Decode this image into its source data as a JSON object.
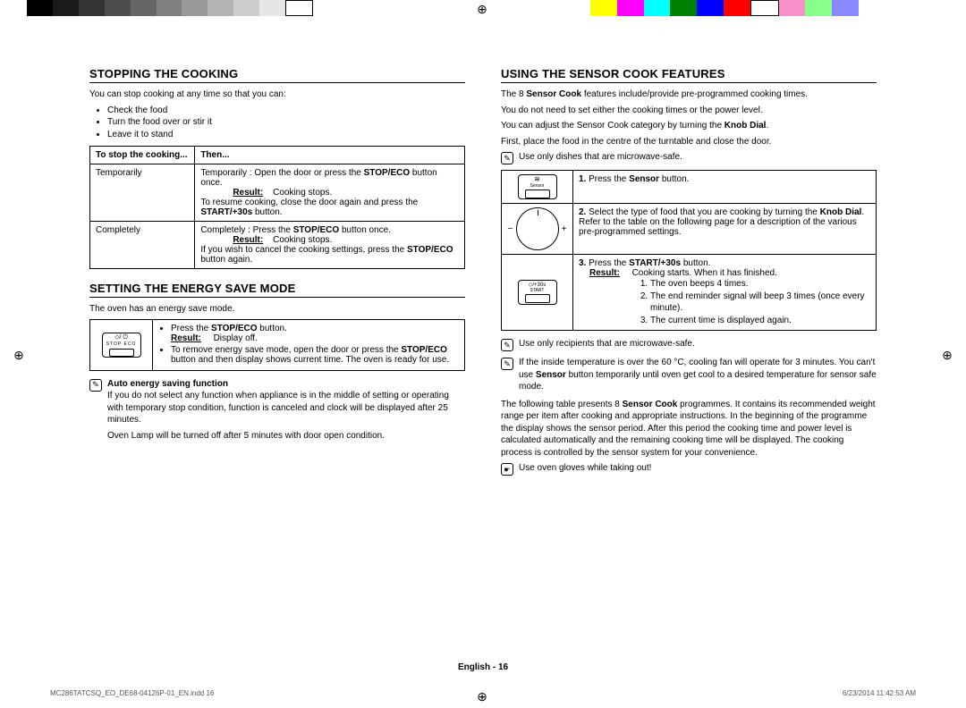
{
  "colorbar_left": [
    "#000",
    "#1a1a1a",
    "#333",
    "#4d4d4d",
    "#666",
    "#808080",
    "#999",
    "#b3b3b3",
    "#ccc",
    "#e6e6e6",
    "#fff"
  ],
  "colorbar_right": [
    "#ff0",
    "#f0f",
    "#0ff",
    "#008000",
    "#00f",
    "#f00",
    "#fff",
    "#f88fc8",
    "#8f8",
    "#88f"
  ],
  "registration_glyph": "⊕",
  "left": {
    "h1": "STOPPING THE COOKING",
    "intro": "You can stop cooking at any time so that you can:",
    "intro_bullets": [
      "Check the food",
      "Turn the food over or stir it",
      "Leave it to stand"
    ],
    "th1": "To stop the cooking...",
    "th2": "Then...",
    "row1_c1": "Temporarily",
    "row1_c2_a": "Temporarily : Open the door or press the ",
    "row1_c2_b": "STOP/ECO",
    "row1_c2_c": " button once.",
    "row1_result_lbl": "Result:",
    "row1_result": "Cooking stops.",
    "row1_resume_a": "To resume cooking, close the door again and press the ",
    "row1_resume_b": "START/+30s",
    "row1_resume_c": " button.",
    "row2_c1": "Completely",
    "row2_c2_a": "Completely : Press the ",
    "row2_c2_b": "STOP/ECO",
    "row2_c2_c": " button once.",
    "row2_result_lbl": "Result:",
    "row2_result": "Cooking stops.",
    "row2_cancel_a": "If you wish to cancel the cooking settings, press the ",
    "row2_cancel_b": "STOP/ECO",
    "row2_cancel_c": " button again.",
    "h2": "SETTING THE ENERGY SAVE MODE",
    "energy_intro": "The oven has an energy save mode.",
    "energy_icon_label": "STOP  ECO",
    "energy_b1_a": "Press the ",
    "energy_b1_b": "STOP/ECO",
    "energy_b1_c": " button.",
    "energy_result_lbl": "Result:",
    "energy_result": "Display off.",
    "energy_b2_a": "To remove energy save mode, open the door or press the ",
    "energy_b2_b": "STOP/ECO",
    "energy_b2_c": " button and then display shows current time. The oven is ready for use.",
    "auto_title": "Auto energy saving function",
    "auto_p1": "If you do not select any function when appliance is in the middle of setting or operating with temporary stop condition, function is canceled and clock will be displayed after 25 minutes.",
    "auto_p2": "Oven Lamp will be turned off after 5 minutes with door open condition."
  },
  "right": {
    "h1": "USING THE SENSOR COOK FEATURES",
    "p1_a": "The 8 ",
    "p1_b": "Sensor Cook",
    "p1_c": " features include/provide pre-programmed cooking times.",
    "p2": "You do not need to set either the cooking times or the power level.",
    "p3_a": "You can adjust the Sensor Cook category by turning the ",
    "p3_b": "Knob Dial",
    "p3_c": ".",
    "p4": "First, place the food in the centre of the turntable and close the door.",
    "note1": "Use only dishes that are microwave-safe.",
    "sensor_label": "Sensor",
    "step1_a": "Press the ",
    "step1_b": "Sensor",
    "step1_c": " button.",
    "step2_a": "Select the type of food that you are cooking by turning the ",
    "step2_b": "Knob Dial",
    "step2_c": ". Refer to the table on the following page for a description of the various pre-programmed settings.",
    "start_label": "START",
    "start_icon_text": "◇/+30s",
    "step3_a": "Press the ",
    "step3_b": "START/+30s",
    "step3_c": " button.",
    "step3_result_lbl": "Result:",
    "step3_result": "Cooking starts. When it has finished.",
    "step3_list": [
      "The oven beeps 4 times.",
      "The end reminder signal will beep 3 times (once every minute).",
      "The current time is displayed again."
    ],
    "note2": "Use only recipients that are microwave-safe.",
    "note3_a": "If the inside temperature is over the 60 °C, cooling fan will operate for 3 minutes. You can't use ",
    "note3_b": "Sensor",
    "note3_c": " button temporarily until oven get cool to a desired temperature for sensor safe mode.",
    "p5_a": "The following table presents 8 ",
    "p5_b": "Sensor Cook",
    "p5_c": " programmes. It contains its recommended weight range per item after cooking and appropriate instructions. In the beginning of the programme the display shows the sensor period. After this period the cooking time and power level is calculated automatically and the remaining cooking time will be displayed. The cooking process is controlled by the sensor system for your convenience.",
    "note4": "Use oven gloves while taking out!"
  },
  "footer": "English - 16",
  "meta_left": "MC286TATCSQ_EO_DE68-04126P-01_EN.indd   16",
  "meta_right": "6/23/2014   11:42:53 AM"
}
